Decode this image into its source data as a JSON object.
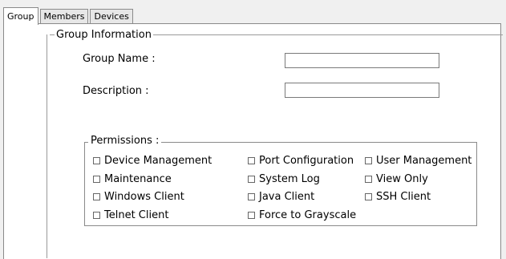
{
  "tabs": [
    {
      "label": "Group"
    },
    {
      "label": "Members"
    },
    {
      "label": "Devices"
    }
  ],
  "group_info": {
    "legend": "Group Information",
    "group_name_label": "Group Name :",
    "group_name_value": "",
    "description_label": "Description :",
    "description_value": ""
  },
  "permissions": {
    "legend": "Permissions :",
    "items": [
      {
        "label": "Device Management",
        "checked": false
      },
      {
        "label": "Port Configuration",
        "checked": false
      },
      {
        "label": "User Management",
        "checked": false
      },
      {
        "label": "Maintenance",
        "checked": false
      },
      {
        "label": "System Log",
        "checked": false
      },
      {
        "label": "View Only",
        "checked": false
      },
      {
        "label": "Windows Client",
        "checked": false
      },
      {
        "label": "Java Client",
        "checked": false
      },
      {
        "label": "SSH Client",
        "checked": false
      },
      {
        "label": "Telnet Client",
        "checked": false
      },
      {
        "label": "Force to Grayscale",
        "checked": false
      }
    ]
  }
}
